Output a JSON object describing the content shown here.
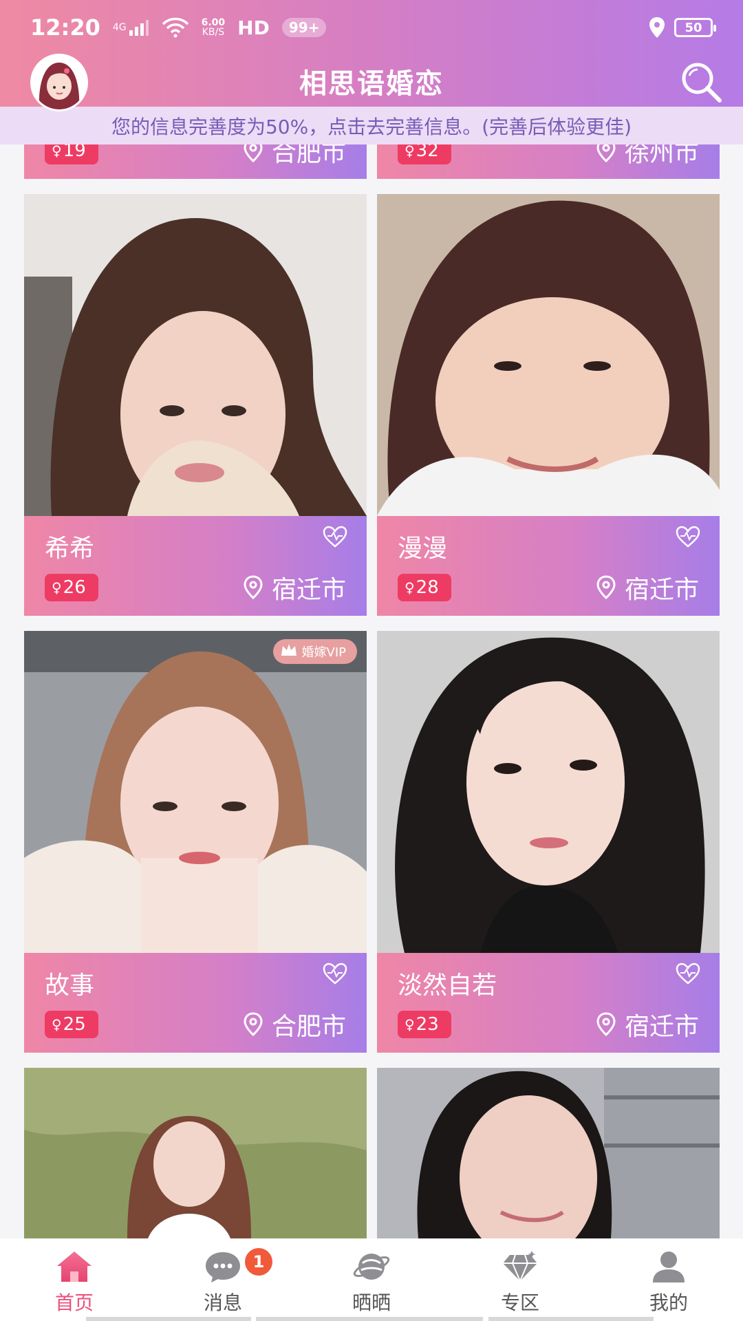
{
  "status": {
    "time": "12:20",
    "network": "4G",
    "speed_top": "6.00",
    "speed_bottom": "KB/S",
    "hd": "HD",
    "notif": "99+",
    "battery": "50"
  },
  "app": {
    "title": "相思语婚恋",
    "info_banner": "您的信息完善度为50%，点击去完善信息。(完善后体验更佳)"
  },
  "partial_cards": [
    {
      "age": "19",
      "city": "合肥市"
    },
    {
      "age": "32",
      "city": "徐州市"
    }
  ],
  "cards": [
    {
      "name": "希希",
      "age": "26",
      "city": "宿迁市",
      "vip": ""
    },
    {
      "name": "漫漫",
      "age": "28",
      "city": "宿迁市",
      "vip": ""
    },
    {
      "name": "故事",
      "age": "25",
      "city": "合肥市",
      "vip": "婚嫁VIP"
    },
    {
      "name": "淡然自若",
      "age": "23",
      "city": "宿迁市",
      "vip": ""
    }
  ],
  "gender_symbol": "♀",
  "tabs": [
    {
      "label": "首页",
      "icon": "home-icon"
    },
    {
      "label": "消息",
      "icon": "chat-icon",
      "badge": "1"
    },
    {
      "label": "晒晒",
      "icon": "planet-icon"
    },
    {
      "label": "专区",
      "icon": "diamond-icon"
    },
    {
      "label": "我的",
      "icon": "user-icon"
    }
  ],
  "colors": {
    "header_start": "#ef8aa3",
    "header_end": "#b57be6",
    "age_badge": "#ee3b63",
    "tab_active": "#ec4f7c",
    "msg_badge": "#f05a3a"
  }
}
